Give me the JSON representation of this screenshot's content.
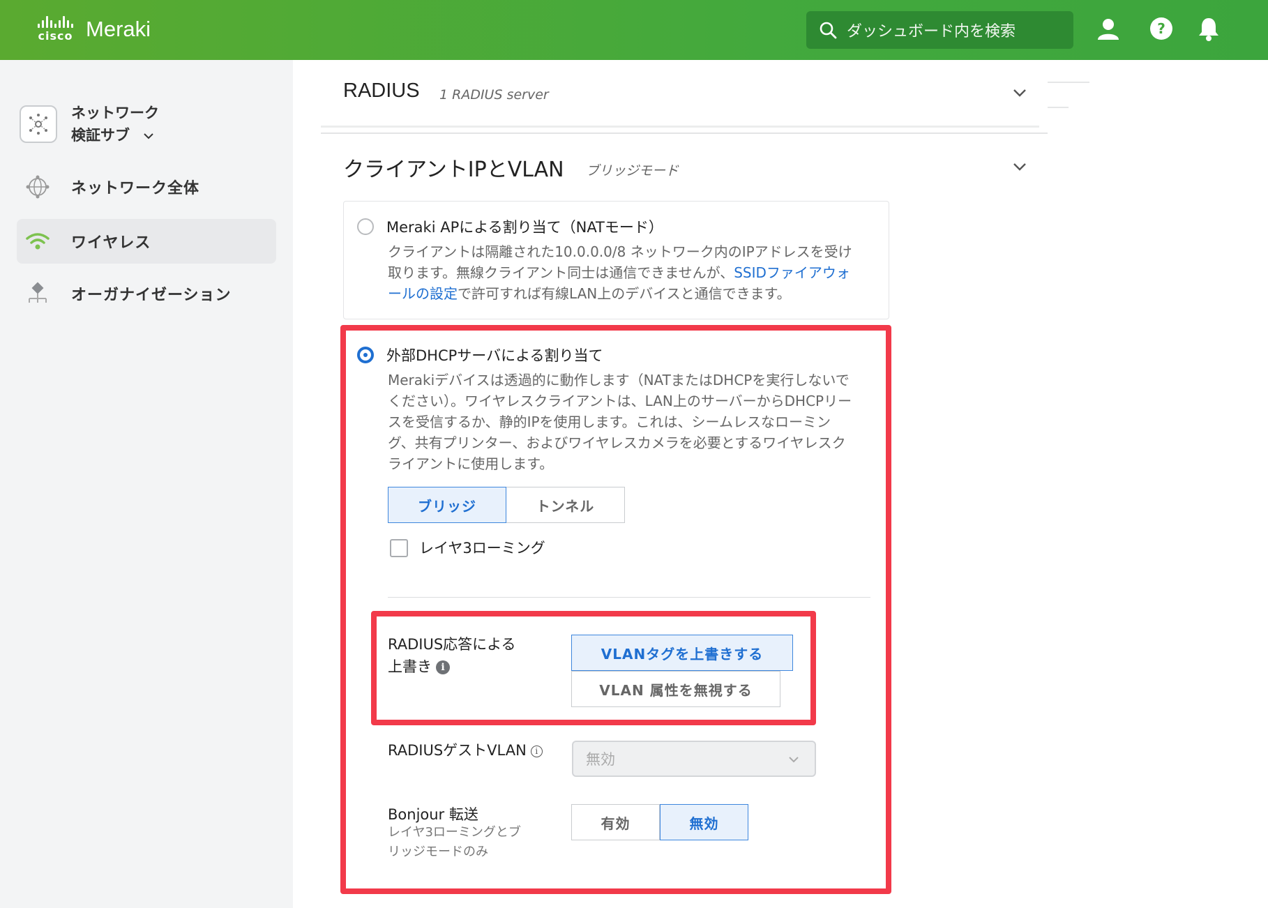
{
  "topbar": {
    "cisco_logo": "cisco",
    "brand": "Meraki",
    "search_placeholder": "ダッシュボード内を検索",
    "icons": [
      "user-icon",
      "help-icon",
      "bell-icon"
    ]
  },
  "sidebar": {
    "network_line1": "ネットワーク",
    "network_line2": "検証サブ",
    "items": [
      {
        "label": "ネットワーク全体",
        "icon": "network-wide-icon"
      },
      {
        "label": "ワイヤレス",
        "icon": "wifi-icon",
        "active": true
      },
      {
        "label": "オーガナイゼーション",
        "icon": "organization-icon"
      }
    ]
  },
  "radius_section": {
    "title": "RADIUS",
    "subtitle": "1 RADIUS server"
  },
  "client_ip_section": {
    "title": "クライアントIPとVLAN",
    "subtitle": "ブリッジモード",
    "nat_option": {
      "title": "Meraki APによる割り当て（NATモード）",
      "desc_line1": "クライアントは隔離された10.0.0.0/8 ネットワーク内のIPアドレスを受け",
      "desc_line2_pre": "取ります。無線クライアント同士は通信できませんが、",
      "desc_line2_link": "SSIDファイアウォ",
      "desc_line3_link": "ールの設定",
      "desc_line3_post": "で許可すれば有線LAN上のデバイスと通信できます。"
    },
    "dhcp_option": {
      "title": "外部DHCPサーバによる割り当て",
      "desc": [
        "Merakiデバイスは透過的に動作します（NATまたはDHCPを実行しないで",
        "ください）。ワイヤレスクライアントは、LAN上のサーバーからDHCPリー",
        "スを受信するか、静的IPを使用します。これは、シームレスなローミン",
        "グ、共有プリンター、およびワイヤレスカメラを必要とするワイヤレスク",
        "ライアントに使用します。"
      ],
      "mode_buttons": [
        "ブリッジ",
        "トンネル"
      ],
      "mode_selected": "ブリッジ",
      "layer3_label": "レイヤ3ローミング",
      "layer3_checked": false
    },
    "radius_override": {
      "label_line1": "RADIUS応答による",
      "label_line2": "上書き",
      "options": [
        "VLANタグを上書きする",
        "VLAN 属性を無視する"
      ],
      "selected": "VLANタグを上書きする"
    },
    "radius_guest_vlan": {
      "label": "RADIUSゲストVLAN",
      "value": "無効"
    },
    "bonjour": {
      "label": "Bonjour 転送",
      "sub_line1": "レイヤ3ローミングとブ",
      "sub_line2": "リッジモードのみ",
      "options": [
        "有効",
        "無効"
      ],
      "selected": "無効"
    }
  },
  "colors": {
    "header_green": "#43a93d",
    "accent_blue": "#1f6fd1",
    "highlight_red": "#f23a4a"
  }
}
